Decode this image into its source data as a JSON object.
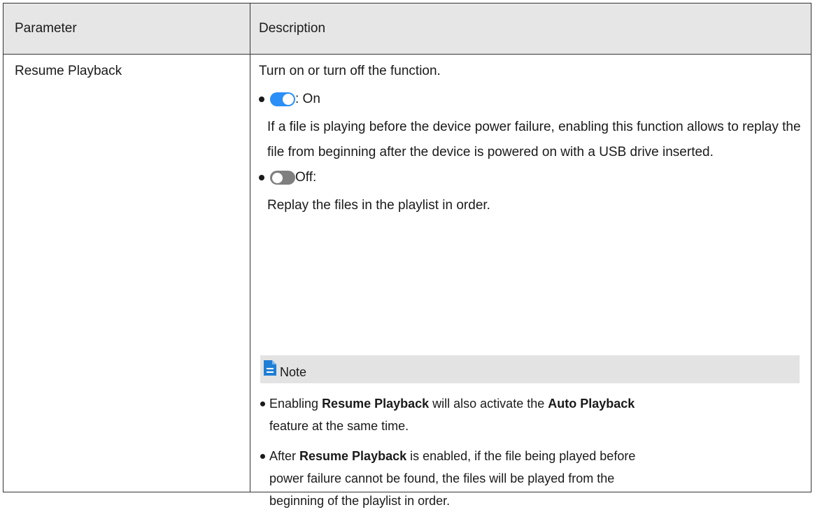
{
  "table": {
    "header": {
      "parameter": "Parameter",
      "description": "Description"
    },
    "row": {
      "parameter": "Resume Playback",
      "intro": "Turn on or turn off the function.",
      "on_label": ": On",
      "on_detail": "If a file is playing before the device power failure, enabling this function allows to replay the file from beginning after the device is powered on with a USB drive inserted.",
      "off_label": "Off:",
      "off_detail": "Replay the files in the playlist in order.",
      "note": {
        "title": "Note",
        "item1": {
          "pre": "Enabling ",
          "b1": "Resume Playback",
          "mid": " will also activate the ",
          "b2": "Auto Playback",
          "post": "feature at the same time."
        },
        "item2": {
          "pre": "After ",
          "b1": "Resume Playback",
          "post1": " is enabled, if the file being played before",
          "line2": "power failure cannot be found, the files will be played from the",
          "line3": "beginning of the playlist in order."
        }
      }
    }
  },
  "colors": {
    "toggle_on": "#2a8ff7",
    "toggle_off": "#7f7f7f",
    "note_icon": "#1f7fd6",
    "header_bg": "#e6e6e6"
  }
}
